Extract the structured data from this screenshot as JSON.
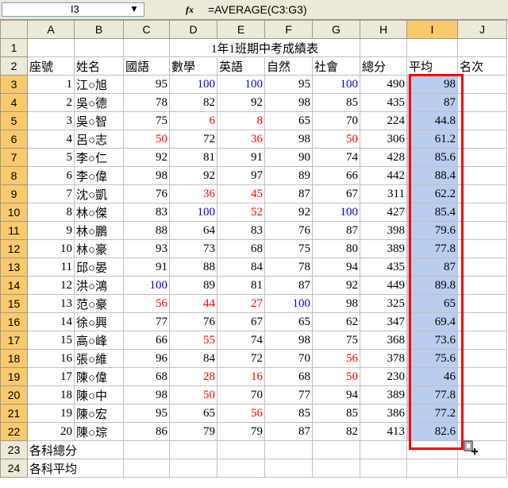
{
  "formula_bar": {
    "name_box": "I3",
    "fx_label": "fx",
    "formula": "=AVERAGE(C3:G3)"
  },
  "columns": [
    "A",
    "B",
    "C",
    "D",
    "E",
    "F",
    "G",
    "H",
    "I",
    "J"
  ],
  "rows": [
    {
      "num": "1",
      "title": "1年1班期中考成績表"
    },
    {
      "num": "2",
      "headers": [
        "座號",
        "姓名",
        "國語",
        "數學",
        "英語",
        "自然",
        "社會",
        "總分",
        "平均",
        "名次"
      ]
    },
    {
      "num": "3",
      "seat": "1",
      "name": "江○旭",
      "scores": [
        "95",
        "100",
        "100",
        "95",
        "100"
      ],
      "total": "490",
      "avg": "98"
    },
    {
      "num": "4",
      "seat": "2",
      "name": "吳○德",
      "scores": [
        "78",
        "82",
        "92",
        "98",
        "85"
      ],
      "total": "435",
      "avg": "87"
    },
    {
      "num": "5",
      "seat": "3",
      "name": "吳○智",
      "scores": [
        "75",
        "6",
        "8",
        "65",
        "70"
      ],
      "total": "224",
      "avg": "44.8"
    },
    {
      "num": "6",
      "seat": "4",
      "name": "呂○志",
      "scores": [
        "50",
        "72",
        "36",
        "98",
        "50"
      ],
      "total": "306",
      "avg": "61.2"
    },
    {
      "num": "7",
      "seat": "5",
      "name": "李○仁",
      "scores": [
        "92",
        "81",
        "91",
        "90",
        "74"
      ],
      "total": "428",
      "avg": "85.6"
    },
    {
      "num": "8",
      "seat": "6",
      "name": "李○偉",
      "scores": [
        "98",
        "92",
        "97",
        "89",
        "66"
      ],
      "total": "442",
      "avg": "88.4"
    },
    {
      "num": "9",
      "seat": "7",
      "name": "沈○凱",
      "scores": [
        "76",
        "36",
        "45",
        "87",
        "67"
      ],
      "total": "311",
      "avg": "62.2"
    },
    {
      "num": "10",
      "seat": "8",
      "name": "林○傑",
      "scores": [
        "83",
        "100",
        "52",
        "92",
        "100"
      ],
      "total": "427",
      "avg": "85.4"
    },
    {
      "num": "11",
      "seat": "9",
      "name": "林○鵬",
      "scores": [
        "88",
        "64",
        "83",
        "76",
        "87"
      ],
      "total": "398",
      "avg": "79.6"
    },
    {
      "num": "12",
      "seat": "10",
      "name": "林○豪",
      "scores": [
        "93",
        "73",
        "68",
        "75",
        "80"
      ],
      "total": "389",
      "avg": "77.8"
    },
    {
      "num": "13",
      "seat": "11",
      "name": "邱○晏",
      "scores": [
        "91",
        "88",
        "84",
        "78",
        "94"
      ],
      "total": "435",
      "avg": "87"
    },
    {
      "num": "14",
      "seat": "12",
      "name": "洪○鴻",
      "scores": [
        "100",
        "89",
        "81",
        "87",
        "92"
      ],
      "total": "449",
      "avg": "89.8"
    },
    {
      "num": "15",
      "seat": "13",
      "name": "范○豪",
      "scores": [
        "56",
        "44",
        "27",
        "100",
        "98"
      ],
      "total": "325",
      "avg": "65"
    },
    {
      "num": "16",
      "seat": "14",
      "name": "徐○興",
      "scores": [
        "77",
        "76",
        "67",
        "65",
        "62"
      ],
      "total": "347",
      "avg": "69.4"
    },
    {
      "num": "17",
      "seat": "15",
      "name": "高○峰",
      "scores": [
        "66",
        "55",
        "74",
        "98",
        "75"
      ],
      "total": "368",
      "avg": "73.6"
    },
    {
      "num": "18",
      "seat": "16",
      "name": "張○維",
      "scores": [
        "96",
        "84",
        "72",
        "70",
        "56"
      ],
      "total": "378",
      "avg": "75.6"
    },
    {
      "num": "19",
      "seat": "17",
      "name": "陳○偉",
      "scores": [
        "68",
        "28",
        "16",
        "68",
        "50"
      ],
      "total": "230",
      "avg": "46"
    },
    {
      "num": "20",
      "seat": "18",
      "name": "陳○中",
      "scores": [
        "98",
        "50",
        "70",
        "77",
        "94"
      ],
      "total": "389",
      "avg": "77.8"
    },
    {
      "num": "21",
      "seat": "19",
      "name": "陳○宏",
      "scores": [
        "95",
        "65",
        "56",
        "85",
        "85"
      ],
      "total": "386",
      "avg": "77.2"
    },
    {
      "num": "22",
      "seat": "20",
      "name": "陳○琮",
      "scores": [
        "86",
        "79",
        "79",
        "87",
        "82"
      ],
      "total": "413",
      "avg": "82.6"
    },
    {
      "num": "23",
      "label": "各科總分"
    },
    {
      "num": "24",
      "label": "各科平均"
    }
  ],
  "colors": {
    "high_score": "#0000ff",
    "low_score": "#ff0000",
    "selection_fill": "#b9cdee",
    "selection_border": "#ff0000",
    "header_bg": "#ece9d8",
    "header_selected_bg": "#f9c96b"
  },
  "icons": {
    "fill_handle": "fill-handle-cross-icon",
    "dropdown": "chevron-down-icon"
  }
}
